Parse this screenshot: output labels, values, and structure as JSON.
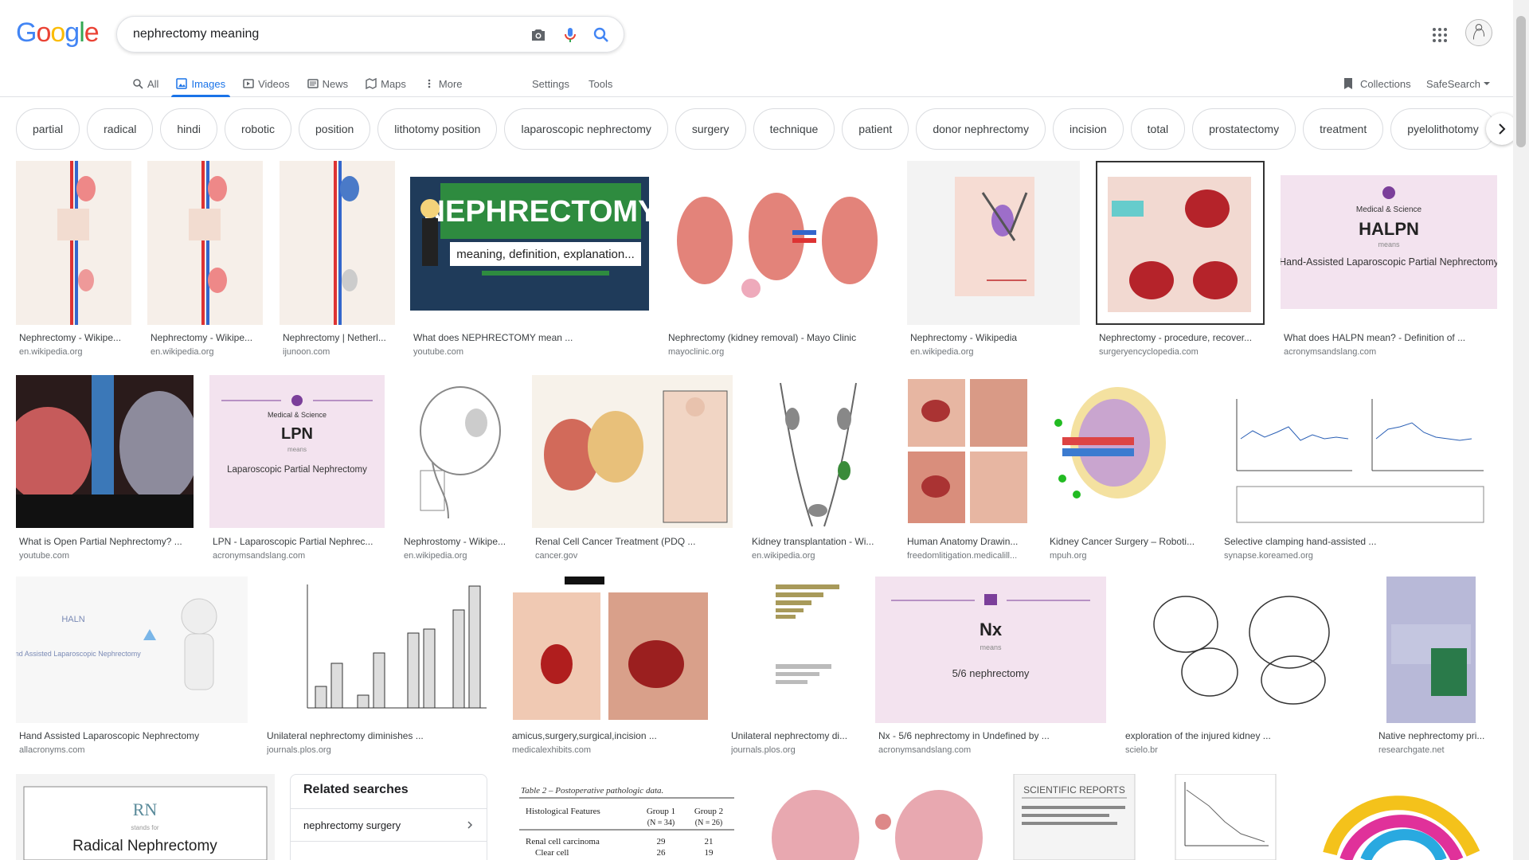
{
  "colors": {
    "blue": "#4285F4",
    "red": "#EA4335",
    "yellow": "#FBBC05",
    "green": "#34A853",
    "accent": "#1a73e8"
  },
  "header": {
    "logo_letters": [
      "G",
      "o",
      "o",
      "g",
      "l",
      "e"
    ],
    "search_query": "nephrectomy meaning",
    "icons": [
      "camera-icon",
      "mic-icon",
      "search-icon",
      "apps-icon",
      "avatar"
    ]
  },
  "tabs": [
    {
      "label": "All",
      "icon": "search-icon"
    },
    {
      "label": "Images",
      "icon": "image-icon",
      "active": true
    },
    {
      "label": "Videos",
      "icon": "video-icon"
    },
    {
      "label": "News",
      "icon": "news-icon"
    },
    {
      "label": "Maps",
      "icon": "map-icon"
    },
    {
      "label": "More",
      "icon": "more-vert-icon"
    }
  ],
  "tools": {
    "settings": "Settings",
    "tools": "Tools",
    "collections": "Collections",
    "safesearch": "SafeSearch"
  },
  "chips": [
    "partial",
    "radical",
    "hindi",
    "robotic",
    "position",
    "lithotomy position",
    "laparoscopic nephrectomy",
    "surgery",
    "technique",
    "patient",
    "donor nephrectomy",
    "incision",
    "total",
    "prostatectomy",
    "treatment",
    "pyelolithotomy"
  ],
  "results": [
    {
      "title": "Nephrectomy - Wikipe...",
      "source": "en.wikipedia.org"
    },
    {
      "title": "Nephrectomy - Wikipe...",
      "source": "en.wikipedia.org"
    },
    {
      "title": "Nephrectomy | Netherl...",
      "source": "ijunoon.com"
    },
    {
      "title": "What does NEPHRECTOMY mean ...",
      "source": "youtube.com",
      "image_text": [
        "NEPHRECTOMY",
        "meaning, definition, explanation..."
      ]
    },
    {
      "title": "Nephrectomy (kidney removal) - Mayo Clinic",
      "source": "mayoclinic.org"
    },
    {
      "title": "Nephrectomy - Wikipedia",
      "source": "en.wikipedia.org"
    },
    {
      "title": "Nephrectomy - procedure, recover...",
      "source": "surgeryencyclopedia.com"
    },
    {
      "title": "What does HALPN mean? - Definition of ...",
      "source": "acronymsandslang.com",
      "image_text": [
        "Medical & Science",
        "HALPN",
        "means",
        "Hand-Assisted Laparoscopic Partial Nephrectomy"
      ]
    },
    {
      "title": "What is Open Partial Nephrectomy? ...",
      "source": "youtube.com"
    },
    {
      "title": "LPN - Laparoscopic Partial Nephrec...",
      "source": "acronymsandslang.com",
      "image_text": [
        "Medical & Science",
        "LPN",
        "means",
        "Laparoscopic Partial Nephrectomy"
      ]
    },
    {
      "title": "Nephrostomy - Wikipe...",
      "source": "en.wikipedia.org"
    },
    {
      "title": "Renal Cell Cancer Treatment (PDQ ...",
      "source": "cancer.gov"
    },
    {
      "title": "Kidney transplantation - Wi...",
      "source": "en.wikipedia.org"
    },
    {
      "title": "Human Anatomy Drawin...",
      "source": "freedomlitigation.medicalill..."
    },
    {
      "title": "Kidney Cancer Surgery – Roboti...",
      "source": "mpuh.org"
    },
    {
      "title": "Selective clamping hand-assisted ...",
      "source": "synapse.koreamed.org"
    },
    {
      "title": "Hand Assisted Laparoscopic Nephrectomy",
      "source": "allacronyms.com",
      "image_text": [
        "HALN",
        "Hand Assisted Laparoscopic Nephrectomy"
      ]
    },
    {
      "title": "Unilateral nephrectomy diminishes ...",
      "source": "journals.plos.org"
    },
    {
      "title": "amicus,surgery,surgical,incision ...",
      "source": "medicalexhibits.com"
    },
    {
      "title": "Unilateral nephrectomy di...",
      "source": "journals.plos.org"
    },
    {
      "title": "Nx - 5/6 nephrectomy in Undefined by ...",
      "source": "acronymsandslang.com",
      "image_text": [
        "Nx",
        "means",
        "5/6 nephrectomy"
      ]
    },
    {
      "title": "exploration of the injured kidney ...",
      "source": "scielo.br"
    },
    {
      "title": "Native nephrectomy pri...",
      "source": "researchgate.net"
    }
  ],
  "bottom_row": [
    {
      "image_text": [
        "RN",
        "stands for",
        "Radical Nephrectomy"
      ]
    },
    {
      "image_text": [
        "Table 2 – Postoperative pathologic data.",
        "Histological Features",
        "Group 1",
        "Group 2",
        "(N = 34)",
        "(N = 26)",
        "Renal cell carcinoma",
        "29",
        "21",
        "Clear cell",
        "26",
        "19"
      ]
    },
    {
      "image_text": []
    },
    {
      "image_text": [
        "SCIENTIFIC REPORTS"
      ]
    },
    {
      "image_text": []
    },
    {
      "image_text": []
    }
  ],
  "related": {
    "heading": "Related searches",
    "items": [
      "nephrectomy surgery"
    ]
  }
}
